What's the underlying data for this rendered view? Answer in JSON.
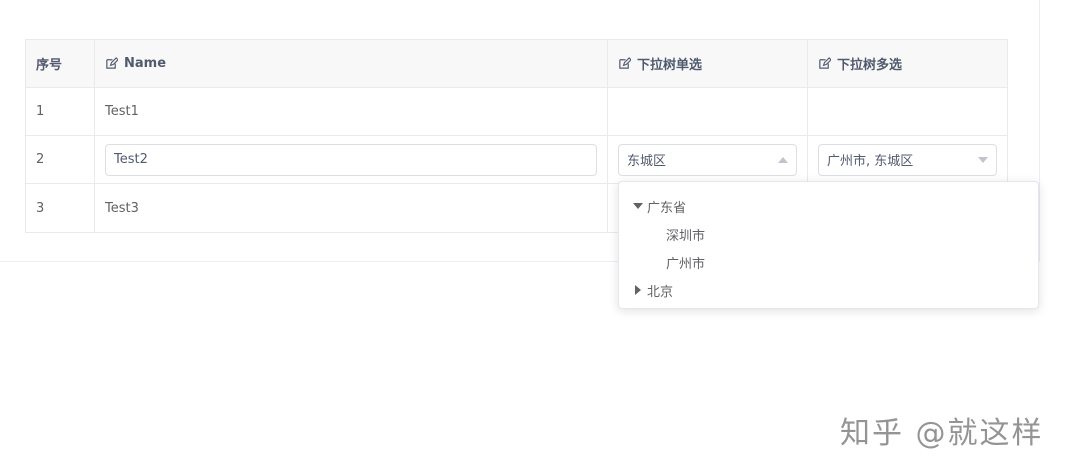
{
  "table": {
    "headers": {
      "index": "序号",
      "name": "Name",
      "single": "下拉树单选",
      "multi": "下拉树多选"
    },
    "rows": [
      {
        "index": "1",
        "name": "Test1",
        "single": "",
        "multi": ""
      },
      {
        "index": "2",
        "name": "Test2",
        "single": "东城区",
        "multi": "广州市, 东城区"
      },
      {
        "index": "3",
        "name": "Test3",
        "single": "",
        "multi": ""
      }
    ]
  },
  "tree_dropdown": {
    "nodes": [
      {
        "label": "广东省",
        "expanded": true,
        "children": [
          "深圳市",
          "广州市"
        ]
      },
      {
        "label": "北京",
        "expanded": false
      }
    ]
  },
  "watermark": "知乎 @就这样",
  "colors": {
    "border": "#e8eaec",
    "header_bg": "#f8f8f9",
    "text": "#606266"
  }
}
